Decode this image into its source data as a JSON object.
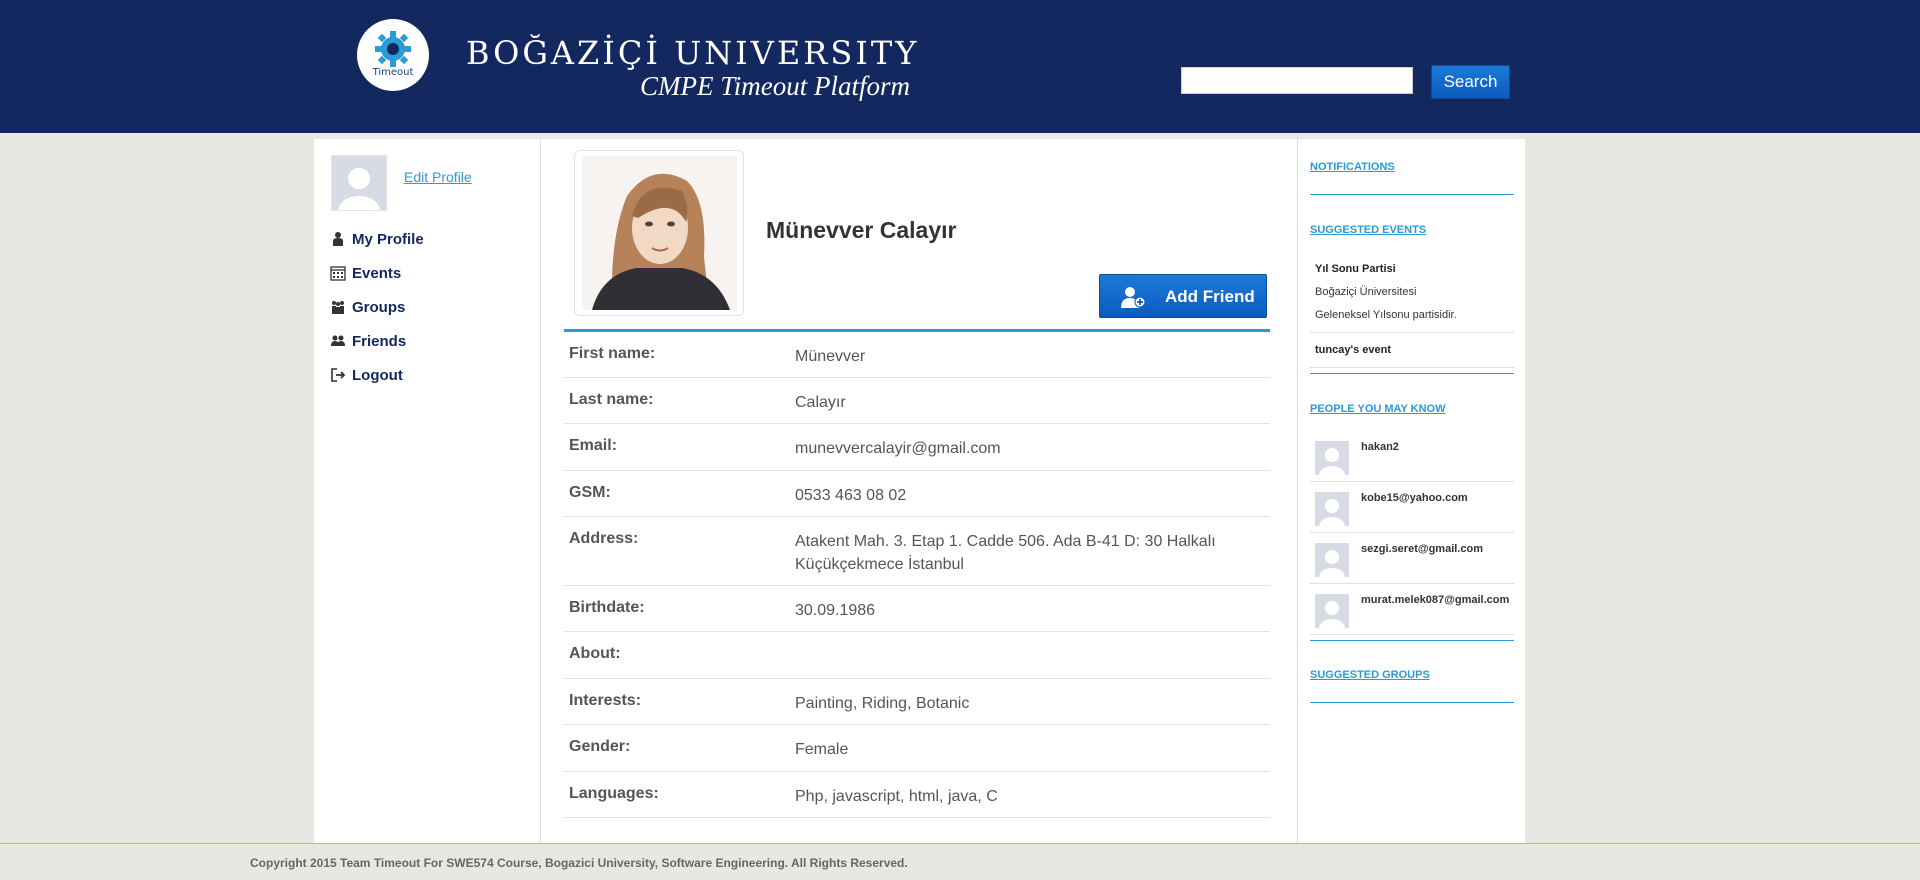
{
  "header": {
    "logo_text": "Timeout",
    "brand_title": "BOĞAZİÇİ UNIVERSITY",
    "brand_subtitle": "CMPE Timeout Platform",
    "search_value": "",
    "search_button": "Search"
  },
  "sidebar": {
    "edit_profile": "Edit Profile",
    "items": [
      {
        "label": "My Profile",
        "icon": "user-icon"
      },
      {
        "label": "Events",
        "icon": "calendar-icon"
      },
      {
        "label": "Groups",
        "icon": "group-icon"
      },
      {
        "label": "Friends",
        "icon": "friends-icon"
      },
      {
        "label": "Logout",
        "icon": "logout-icon"
      }
    ]
  },
  "profile": {
    "name": "Münevver Calayır",
    "add_friend": "Add Friend",
    "fields": [
      {
        "label": "First name:",
        "value": "Münevver"
      },
      {
        "label": "Last name:",
        "value": "Calayır"
      },
      {
        "label": "Email:",
        "value": "munevvercalayir@gmail.com"
      },
      {
        "label": "GSM:",
        "value": "0533 463 08 02"
      },
      {
        "label": "Address:",
        "value": "Atakent Mah. 3. Etap 1. Cadde 506. Ada B-41 D: 30 Halkalı Küçükçekmece İstanbul"
      },
      {
        "label": "Birthdate:",
        "value": "30.09.1986"
      },
      {
        "label": "About:",
        "value": ""
      },
      {
        "label": "Interests:",
        "value": "Painting, Riding, Botanic"
      },
      {
        "label": "Gender:",
        "value": "Female"
      },
      {
        "label": "Languages:",
        "value": "Php, javascript, html, java, C"
      }
    ]
  },
  "right_sidebar": {
    "notifications": "NOTIFICATIONS",
    "suggested_events": "SUGGESTED EVENTS",
    "events": [
      {
        "title": "Yıl Sonu Partisi",
        "location": "Boğaziçi Üniversitesi",
        "description": "Geleneksel Yılsonu partisidir."
      },
      {
        "title": "tuncay's event"
      }
    ],
    "people_heading": "PEOPLE YOU MAY KNOW",
    "people": [
      "hakan2",
      "kobe15@yahoo.com",
      "sezgi.seret@gmail.com",
      "murat.melek087@gmail.com"
    ],
    "suggested_groups": "SUGGESTED GROUPS"
  },
  "footer": {
    "copyright": "Copyright 2015 Team Timeout For SWE574 Course, Bogazici University, Software Engineering. All Rights Reserved."
  },
  "colors": {
    "header_bg": "#13285e",
    "accent": "#2a9bd7",
    "button": "#0b5bbd",
    "page_bg": "#e8e8e3"
  }
}
